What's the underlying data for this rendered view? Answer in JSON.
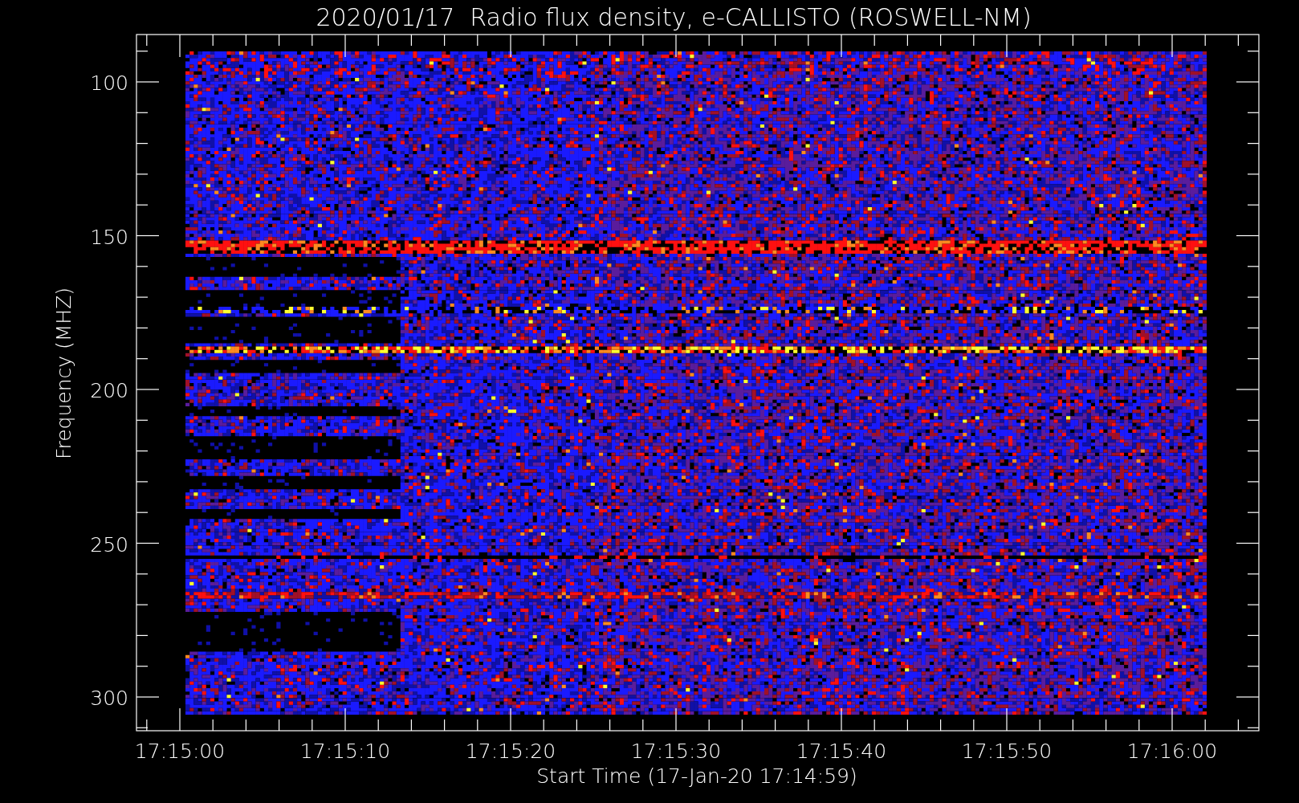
{
  "title": "2020/01/17  Radio flux density, e-CALLISTO (ROSWELL-NM)",
  "y_axis": {
    "label": "Frequency (MHZ)",
    "ticks": [
      "100",
      "150",
      "200",
      "250",
      "300"
    ]
  },
  "x_axis": {
    "label": "Start Time (17-Jan-20 17:14:59)",
    "ticks": [
      "17:15:00",
      "17:15:10",
      "17:15:20",
      "17:15:30",
      "17:15:40",
      "17:15:50",
      "17:16:00"
    ]
  }
}
